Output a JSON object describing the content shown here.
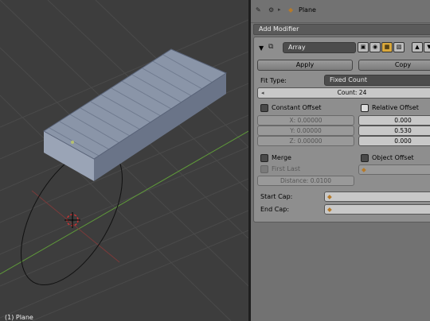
{
  "viewport": {
    "object_label": "(1) Plane"
  },
  "header": {
    "breadcrumb_object": "Plane"
  },
  "add_modifier": {
    "label": "Add Modifier"
  },
  "modifier": {
    "name": "Array",
    "apply_label": "Apply",
    "copy_label": "Copy",
    "fit_type_label": "Fit Type:",
    "fit_type_value": "Fixed Count",
    "count_text": "Count: 24",
    "constant_offset": {
      "label": "Constant Offset",
      "checked": false,
      "x": "X: 0.00000",
      "y": "Y: 0.00000",
      "z": "Z: 0.00000"
    },
    "relative_offset": {
      "label": "Relative Offset",
      "checked": true,
      "x": "0.000",
      "y": "0.530",
      "z": "0.000"
    },
    "merge": {
      "label": "Merge",
      "checked": false
    },
    "first_last": {
      "label": "First Last",
      "checked": false
    },
    "distance": "Distance: 0.0100",
    "object_offset": {
      "label": "Object Offset",
      "checked": false
    },
    "start_cap_label": "Start Cap:",
    "end_cap_label": "End Cap:"
  },
  "colors": {
    "viewport_bg": "#3d3d3d",
    "mesh": "#8a95a8",
    "panel_bg": "#727272",
    "grid_green": "#5f9a3a",
    "grid_red": "#9a3a3a"
  },
  "icons": [
    "pin-icon",
    "scene-icon",
    "object-icon",
    "wrench-icon",
    "collapse-arrow-icon",
    "array-modifier-icon",
    "render-icon",
    "eye-icon",
    "editmode-icon",
    "cage-icon",
    "move-up-icon",
    "object-field-icon"
  ]
}
